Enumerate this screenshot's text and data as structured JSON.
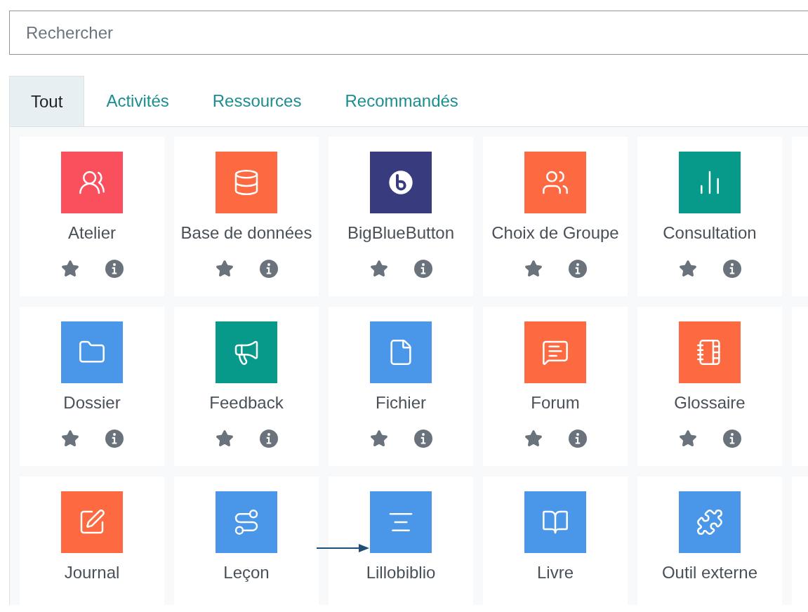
{
  "search": {
    "placeholder": "Rechercher"
  },
  "tabs": [
    {
      "label": "Tout",
      "selected": true
    },
    {
      "label": "Activités",
      "selected": false
    },
    {
      "label": "Ressources",
      "selected": false
    },
    {
      "label": "Recommandés",
      "selected": false
    }
  ],
  "modules": [
    {
      "name": "Atelier",
      "color": "#fa505e"
    },
    {
      "name": "Base de données",
      "color": "#fd6941"
    },
    {
      "name": "BigBlueButton",
      "color": "#393b7f"
    },
    {
      "name": "Choix de Groupe",
      "color": "#fd6941"
    },
    {
      "name": "Consultation",
      "color": "#079a8a"
    },
    {
      "name": "Dossier",
      "color": "#4a96e8"
    },
    {
      "name": "Feedback",
      "color": "#079a8a"
    },
    {
      "name": "Fichier",
      "color": "#4a96e8"
    },
    {
      "name": "Forum",
      "color": "#fd6941"
    },
    {
      "name": "Glossaire",
      "color": "#fd6941"
    },
    {
      "name": "Journal",
      "color": "#fd6941"
    },
    {
      "name": "Leçon",
      "color": "#4a96e8"
    },
    {
      "name": "Lillobiblio",
      "color": "#4a96e8"
    },
    {
      "name": "Livre",
      "color": "#4a96e8"
    },
    {
      "name": "Outil externe",
      "color": "#4a96e8"
    }
  ]
}
